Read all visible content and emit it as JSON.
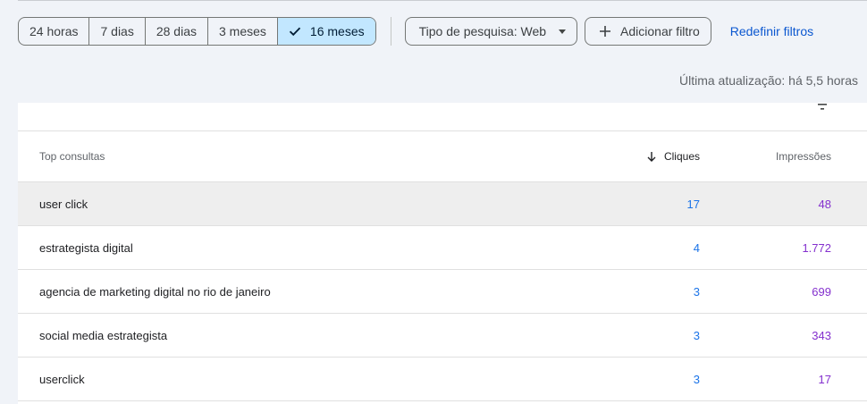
{
  "date_ranges": [
    {
      "label": "24 horas",
      "active": false
    },
    {
      "label": "7 dias",
      "active": false
    },
    {
      "label": "28 dias",
      "active": false
    },
    {
      "label": "3 meses",
      "active": false
    },
    {
      "label": "16 meses",
      "active": true
    }
  ],
  "search_type_label": "Tipo de pesquisa: Web",
  "add_filter_label": "Adicionar filtro",
  "reset_filters_label": "Redefinir filtros",
  "last_updated": "Última atualização: há 5,5 horas",
  "table": {
    "headers": {
      "query": "Top consultas",
      "clicks": "Cliques",
      "impressions": "Impressões"
    },
    "sort": {
      "column": "clicks",
      "direction": "descending"
    },
    "rows": [
      {
        "query": "user click",
        "clicks": "17",
        "impressions": "48"
      },
      {
        "query": "estrategista digital",
        "clicks": "4",
        "impressions": "1.772"
      },
      {
        "query": "agencia de marketing digital no rio de janeiro",
        "clicks": "3",
        "impressions": "699"
      },
      {
        "query": "social media estrategista",
        "clicks": "3",
        "impressions": "343"
      },
      {
        "query": "userclick",
        "clicks": "3",
        "impressions": "17"
      }
    ]
  },
  "colors": {
    "clicks": "#1a73e8",
    "impressions": "#8430ce",
    "active_range": "#c2e7ff",
    "link": "#0b57d0"
  },
  "icons": {
    "active_range": "check-icon",
    "search_type": "dropdown-arrow-icon",
    "add_filter": "plus-icon",
    "table_filter": "filter-icon",
    "sort": "arrow-down-icon"
  }
}
